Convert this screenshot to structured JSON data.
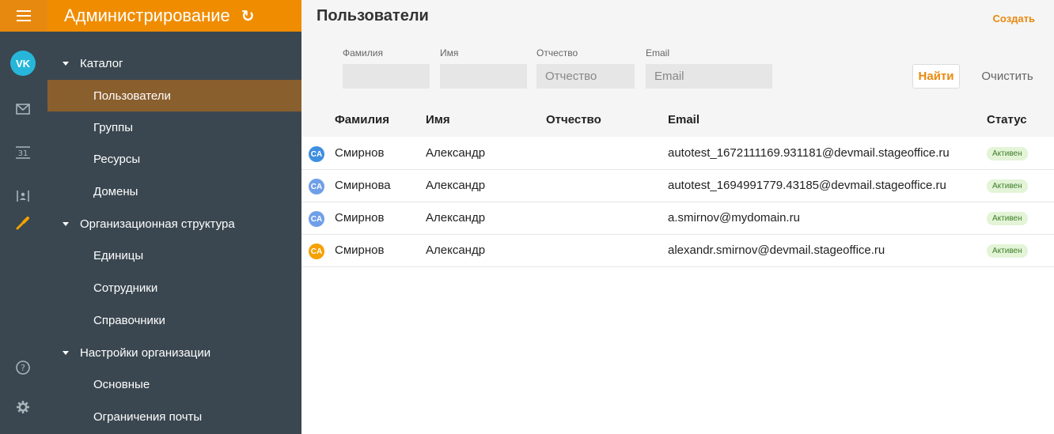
{
  "colors": {
    "accent": "#f08c00",
    "sidebar_bg": "#3a4750",
    "active_item_bg": "#8a5f2e",
    "avatar_vk": "#27b6d9",
    "avatar_blue": "#3f8fe0",
    "avatar_orange": "#f5a100",
    "status_bg": "#e3f4d7"
  },
  "rail": {
    "avatar_initials": "VK",
    "icons": [
      "menu-icon",
      "mail-icon",
      "calendar-icon",
      "contacts-icon",
      "wrench-icon",
      "help-icon",
      "settings-gear-icon"
    ],
    "calendar_day": "31"
  },
  "sidebar": {
    "title": "Администрирование",
    "sections": [
      {
        "label": "Каталог",
        "items": [
          "Пользователи",
          "Группы",
          "Ресурсы",
          "Домены"
        ]
      },
      {
        "label": "Организационная структура",
        "items": [
          "Единицы",
          "Сотрудники",
          "Справочники"
        ]
      },
      {
        "label": "Настройки организации",
        "items": [
          "Основные",
          "Ограничения почты"
        ]
      }
    ],
    "active_item": "Пользователи"
  },
  "page": {
    "title": "Пользователи",
    "create_label": "Создать"
  },
  "filters": {
    "lastname_label": "Фамилия",
    "lastname_value": "",
    "firstname_label": "Имя",
    "firstname_value": "",
    "middlename_label": "Отчество",
    "middlename_placeholder": "Отчество",
    "email_label": "Email",
    "email_placeholder": "Email",
    "find_label": "Найти",
    "clear_label": "Очистить"
  },
  "table": {
    "columns": [
      "Фамилия",
      "Имя",
      "Отчество",
      "Email",
      "Статус"
    ],
    "rows": [
      {
        "initials": "CA",
        "avatar_color": "#3f8fe0",
        "lastname": "Смирнов",
        "firstname": "Александр",
        "middlename": "",
        "email": "autotest_1672111169.931181@devmail.stageoffice.ru",
        "status": "Активен"
      },
      {
        "initials": "CA",
        "avatar_color": "#6f9fe8",
        "lastname": "Смирнова",
        "firstname": "Александр",
        "middlename": "",
        "email": "autotest_1694991779.43185@devmail.stageoffice.ru",
        "status": "Активен"
      },
      {
        "initials": "CA",
        "avatar_color": "#6f9fe8",
        "lastname": "Смирнов",
        "firstname": "Александр",
        "middlename": "",
        "email": "a.smirnov@mydomain.ru",
        "status": "Активен"
      },
      {
        "initials": "CA",
        "avatar_color": "#f5a100",
        "lastname": "Смирнов",
        "firstname": "Александр",
        "middlename": "",
        "email": "alexandr.smirnov@devmail.stageoffice.ru",
        "status": "Активен"
      }
    ]
  }
}
